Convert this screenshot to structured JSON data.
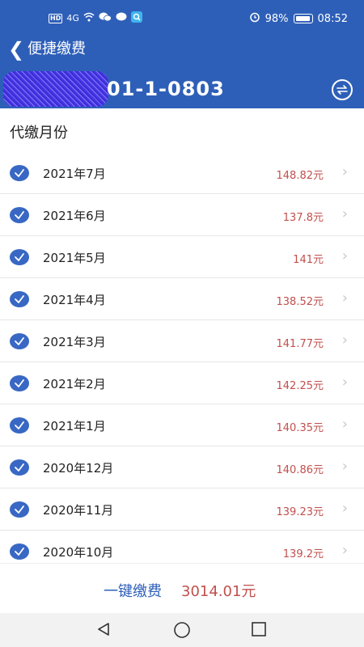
{
  "status": {
    "hd": "HD",
    "signal": "4G",
    "battery_percent": "98%",
    "time": "08:52"
  },
  "nav": {
    "title": "便捷缴费"
  },
  "banner": {
    "house_code": "01-1-0803"
  },
  "section_title": "代缴月份",
  "months": [
    {
      "label": "2021年7月",
      "amount": "148.82元"
    },
    {
      "label": "2021年6月",
      "amount": "137.8元"
    },
    {
      "label": "2021年5月",
      "amount": "141元"
    },
    {
      "label": "2021年4月",
      "amount": "138.52元"
    },
    {
      "label": "2021年3月",
      "amount": "141.77元"
    },
    {
      "label": "2021年2月",
      "amount": "142.25元"
    },
    {
      "label": "2021年1月",
      "amount": "140.35元"
    },
    {
      "label": "2020年12月",
      "amount": "140.86元"
    },
    {
      "label": "2020年11月",
      "amount": "139.23元"
    },
    {
      "label": "2020年10月",
      "amount": "139.2元"
    }
  ],
  "pay": {
    "label": "一键缴费",
    "total": "3014.01元"
  },
  "colors": {
    "primary": "#2e5fb8",
    "amount": "#c0504d"
  }
}
